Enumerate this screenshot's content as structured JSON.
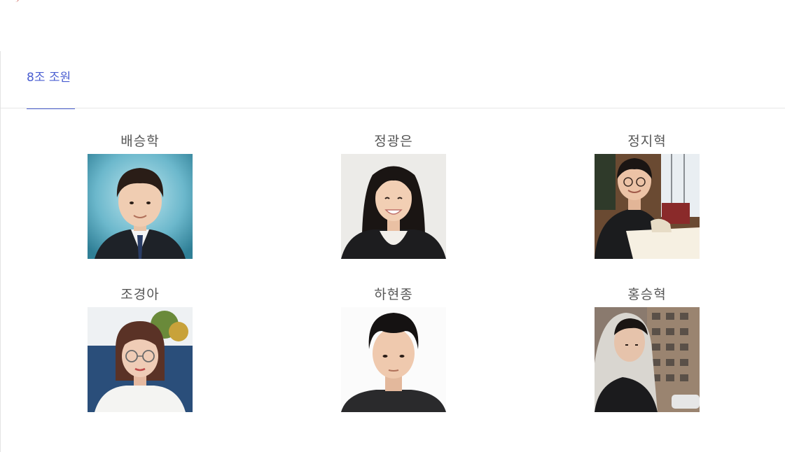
{
  "tabs": [
    {
      "label": "8조 조원",
      "active": true
    }
  ],
  "members": [
    {
      "name": "배승학",
      "photo": "portrait-suit-blue-background"
    },
    {
      "name": "정광은",
      "photo": "portrait-long-hair-smiling"
    },
    {
      "name": "정지혁",
      "photo": "portrait-cafe-with-box"
    },
    {
      "name": "조경아",
      "photo": "portrait-glasses-couch"
    },
    {
      "name": "하현종",
      "photo": "portrait-plain-white-background"
    },
    {
      "name": "홍승혁",
      "photo": "portrait-hoodie-street"
    }
  ],
  "colors": {
    "accent": "#4a5ed1",
    "name_text": "#555555",
    "divider": "#e6e6e6"
  }
}
